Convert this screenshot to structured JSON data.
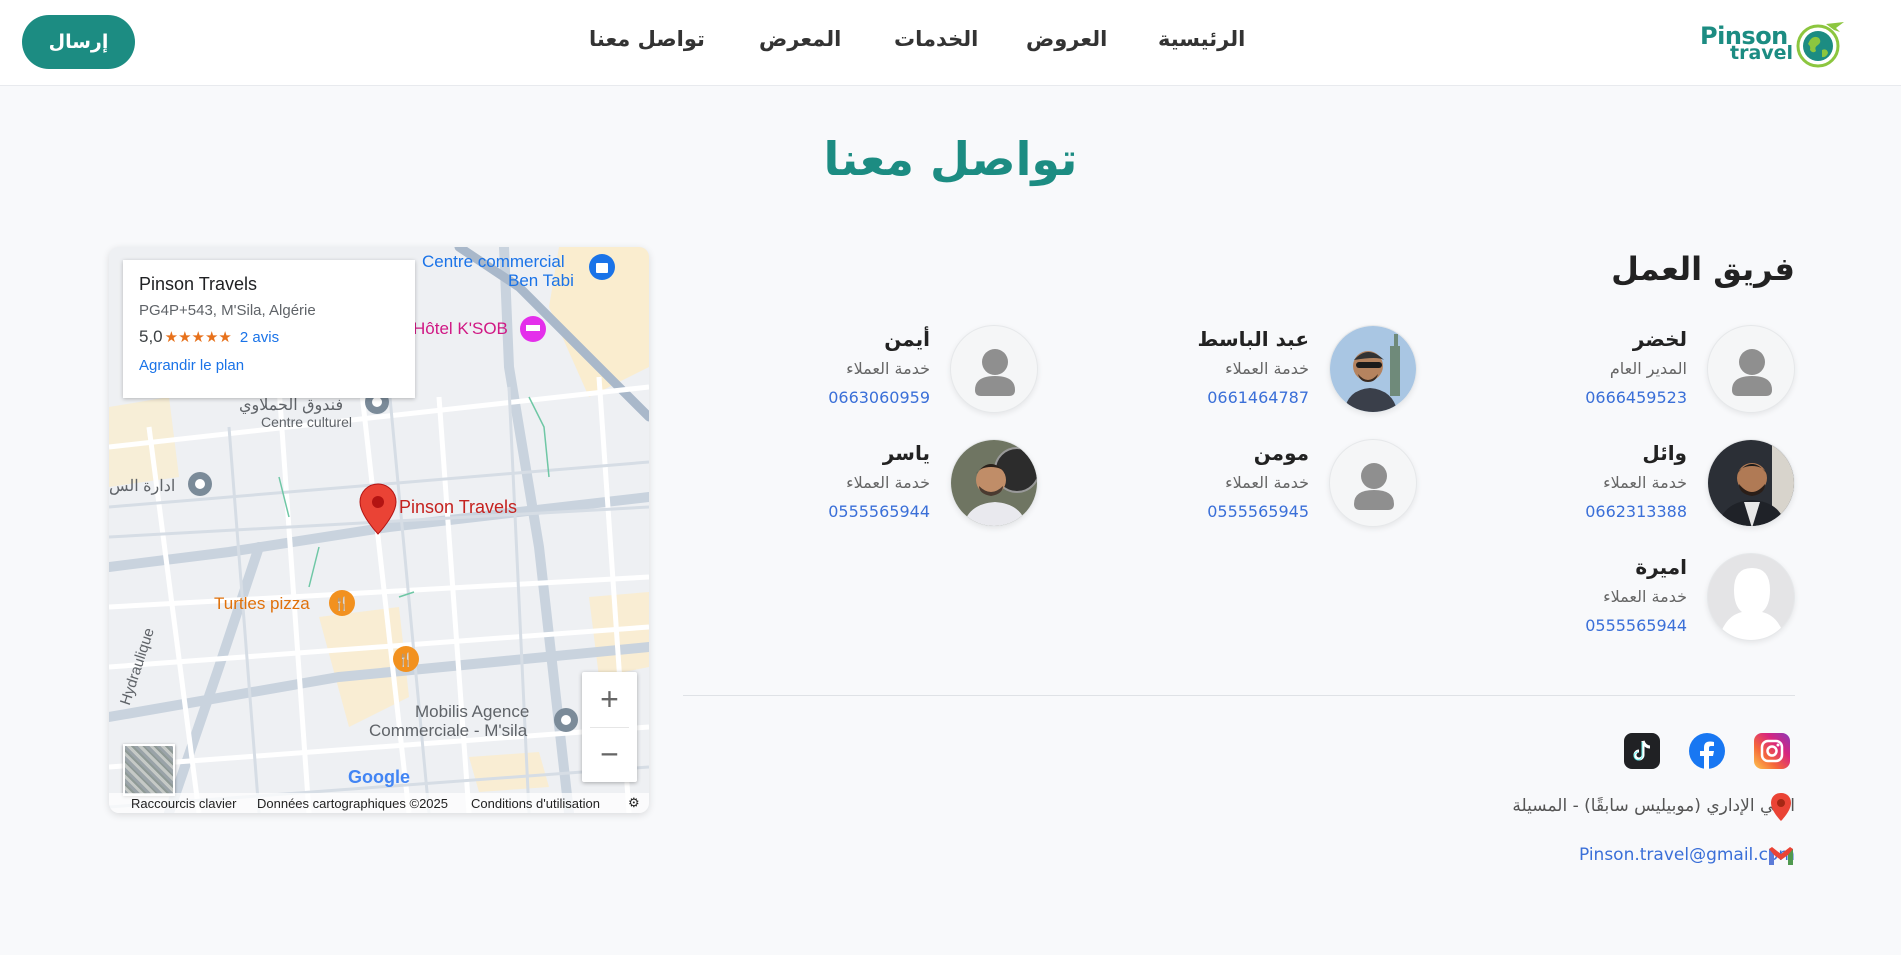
{
  "header": {
    "send_label": "إرسال",
    "nav": [
      "الرئيسية",
      "العروض",
      "الخدمات",
      "المعرض",
      "تواصل معنا"
    ],
    "logo_line1": "Pinson",
    "logo_line2": "travel"
  },
  "page_title": "تواصل معنا",
  "map": {
    "place_name": "Pinson Travels",
    "address": "PG4P+543, M'Sila, Algérie",
    "rating": "5,0",
    "stars": "★★★★★",
    "reviews": "2 avis",
    "enlarge": "Agrandir le plan",
    "labels": {
      "centre_commercial": "Centre commercial",
      "ben_tabi": "Ben Tabi",
      "hotel": "Hôtel K'SOB",
      "fondouk": "فندوق الحملاوي",
      "centre_culturel": "Centre culturel",
      "idara": "ادارة الس",
      "pin_label": "Pinson Travels",
      "turtles": "Turtles pizza",
      "mobilis1": "Mobilis Agence",
      "mobilis2": "Commerciale - M'sila",
      "street": "Hydraulique",
      "google": "Google"
    },
    "zoom_in": "+",
    "zoom_out": "−",
    "footer": {
      "shortcuts": "Raccourcis clavier",
      "data": "Données cartographiques ©2025",
      "terms": "Conditions d'utilisation"
    }
  },
  "team": {
    "title": "فريق العمل",
    "members": [
      {
        "name": "لخضر",
        "role": "المدير العام",
        "phone": "0666459523",
        "avatar": "placeholder-icon"
      },
      {
        "name": "عبد الباسط",
        "role": "خدمة العملاء",
        "phone": "0661464787",
        "avatar": "photo"
      },
      {
        "name": "أيمن",
        "role": "خدمة العملاء",
        "phone": "0663060959",
        "avatar": "placeholder-icon"
      },
      {
        "name": "وائل",
        "role": "خدمة العملاء",
        "phone": "0662313388",
        "avatar": "photo"
      },
      {
        "name": "مومن",
        "role": "خدمة العملاء",
        "phone": "0555565945",
        "avatar": "placeholder-icon"
      },
      {
        "name": "ياسر",
        "role": "خدمة العملاء",
        "phone": "0555565944",
        "avatar": "photo"
      },
      {
        "name": "اميرة",
        "role": "خدمة العملاء",
        "phone": "0555565944",
        "avatar": "female-silhouette-icon"
      }
    ]
  },
  "contact": {
    "address": "الحي الإداري (موبيليس سابقًا) - المسيلة",
    "email": "Pinson.travel@gmail.com"
  },
  "colors": {
    "brand": "#1c8c82",
    "link": "#3a6fd8",
    "map_pin": "#ea4335"
  }
}
